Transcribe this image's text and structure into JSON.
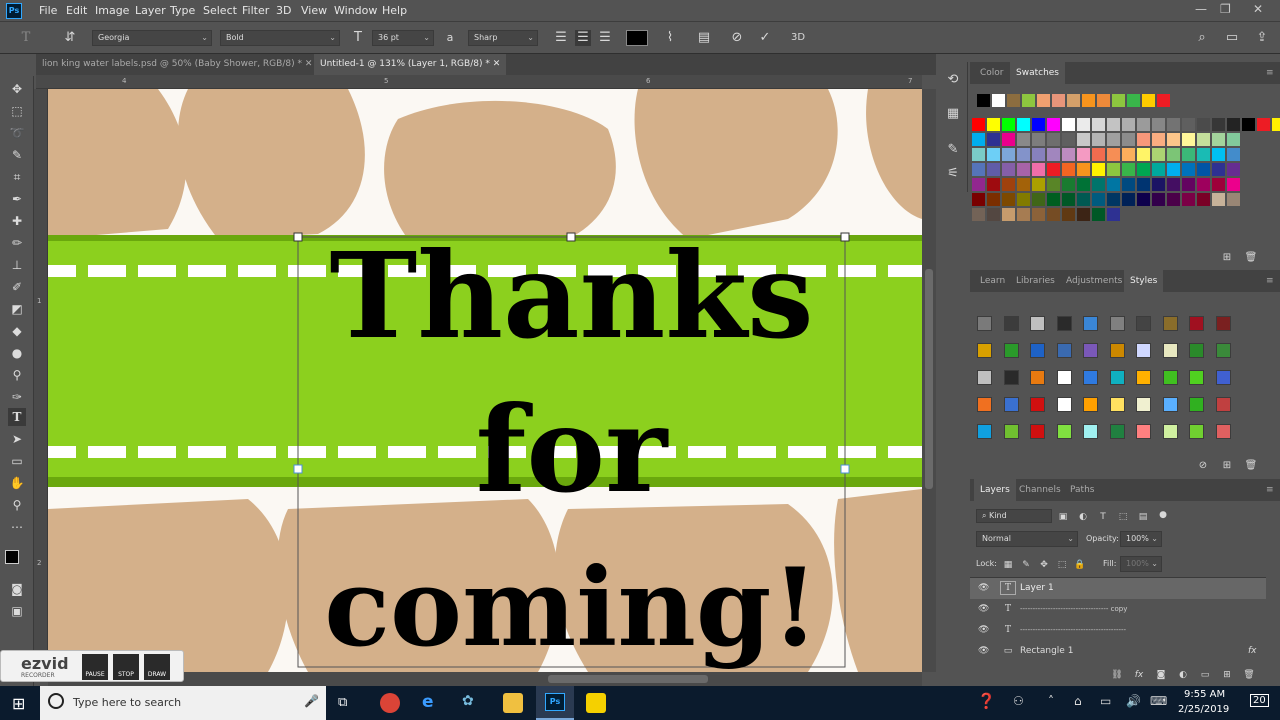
{
  "app": {
    "logo": "Ps"
  },
  "menu": [
    "File",
    "Edit",
    "Image",
    "Layer",
    "Type",
    "Select",
    "Filter",
    "3D",
    "View",
    "Window",
    "Help"
  ],
  "window_controls": {
    "minimize": "—",
    "maximize": "❐",
    "close": "✕"
  },
  "options": {
    "font_family": "Georgia",
    "font_style": "Bold",
    "font_size": "36 pt",
    "antialias_icon": "a",
    "antialias": "Sharp",
    "text_color": "#000000"
  },
  "tabs": [
    {
      "label": "lion king water labels.psd @ 50% (Baby Shower, RGB/8) *",
      "close": "✕"
    },
    {
      "label": "Untitled-1 @ 131% (Layer 1, RGB/8) *",
      "close": "✕"
    }
  ],
  "ruler": {
    "top": [
      "4",
      "5",
      "6",
      "7"
    ],
    "left": [
      "1",
      "2"
    ]
  },
  "canvas": {
    "line1": "Thanks",
    "line2": "for",
    "line3": "coming!",
    "colors": {
      "giraffe": "#d4b08a",
      "band": "#8cd01e",
      "band_dark": "#6aa80d",
      "stitch": "#ffffff"
    }
  },
  "color_panel": {
    "tabs": [
      "Color",
      "Swatches"
    ],
    "active_tab": "Swatches",
    "top_row": [
      "#000000",
      "#ffffff",
      "#8c6d3f",
      "#8dc63f",
      "#f0a070",
      "#e8957a",
      "#d4a06a",
      "#f7941d",
      "#ee8a3a",
      "#8dc63f",
      "#39b54a",
      "#ffcc00",
      "#ed1c24"
    ],
    "grid": [
      [
        "#ff0000",
        "#ffff00",
        "#00ff00",
        "#00ffff",
        "#0000ff",
        "#ff00ff",
        "#ffffff",
        "#ebebeb",
        "#d7d7d7",
        "#c3c3c3",
        "#afafaf",
        "#9b9b9b",
        "#878787",
        "#737373",
        "#5f5f5f",
        "#4b4b4b",
        "#373737",
        "#232323",
        "#000000",
        "#ed1c24",
        "#fff200",
        "#00a651"
      ],
      [
        "#00aeef",
        "#2e3192",
        "#ec008c",
        "#898989",
        "#7d7d7d",
        "#6e6e6e",
        "#5f5f5f",
        "#c8c8c8",
        "#b4b4b4",
        "#a0a0a0",
        "#8c8c8c",
        "#f7977a",
        "#f9ad81",
        "#fdc68a",
        "#fff79a",
        "#c4df9b",
        "#a3d39c",
        "#82ca9c"
      ],
      [
        "#7accc8",
        "#6dcff6",
        "#7da7d9",
        "#8393ca",
        "#8781bd",
        "#a186be",
        "#bd8cbf",
        "#f49ac2",
        "#f26c4f",
        "#f68e55",
        "#fbaf5c",
        "#fff467",
        "#acd372",
        "#7cc576",
        "#3bb878",
        "#1abbb4",
        "#00bff3",
        "#438ccb"
      ],
      [
        "#5574b9",
        "#605ca8",
        "#855fa8",
        "#a763a8",
        "#f06ea9",
        "#ed1c24",
        "#f26522",
        "#f7941d",
        "#fff200",
        "#8dc73f",
        "#39b54a",
        "#00a651",
        "#00a99d",
        "#00aeef",
        "#0072bc",
        "#0054a6",
        "#2e3192",
        "#662d91"
      ],
      [
        "#92278f",
        "#9e0b0f",
        "#a0410d",
        "#a36209",
        "#aba000",
        "#598527",
        "#197b30",
        "#007236",
        "#00746b",
        "#0076a3",
        "#004a80",
        "#003471",
        "#1b1464",
        "#440e62",
        "#630460",
        "#9e005d",
        "#9e0039",
        "#ec008c"
      ],
      [
        "#790000",
        "#7b2e00",
        "#7d4900",
        "#827b00",
        "#406618",
        "#005e20",
        "#005826",
        "#005952",
        "#005b7f",
        "#003663",
        "#002157",
        "#0d004c",
        "#32004b",
        "#4b0049",
        "#7b0046",
        "#7a0026",
        "#c7b299",
        "#998675"
      ],
      [
        "#736357",
        "#534741",
        "#c69c6d",
        "#a67c52",
        "#8c6239",
        "#754c24",
        "#603913",
        "#3c2415",
        "#005826",
        "#2e3192"
      ]
    ]
  },
  "styles_panel": {
    "tabs": [
      "Learn",
      "Libraries",
      "Adjustments",
      "Styles"
    ],
    "active_tab": "Styles",
    "grid": [
      [
        "#7a7a7a",
        "#3c3c3c",
        "#c0c0c0",
        "#2a2a2a",
        "#3a86d6",
        "#808080",
        "#444444",
        "#8a6d2a",
        "#a01020",
        "#7a2020"
      ],
      [
        "#d8a000",
        "#2a9a2a",
        "#1e62c6",
        "#3a6ab0",
        "#7a58b8",
        "#cc8800",
        "#d0d8ff",
        "#e8e8c0",
        "#2a8a2a",
        "#3a8a3a"
      ],
      [
        "#c0c0c0",
        "#2a2a2a",
        "#e87a10",
        "#ffffff",
        "#2f7ae0",
        "#10b0c0",
        "#ffb000",
        "#40c020",
        "#50d020",
        "#4060d0"
      ],
      [
        "#f07020",
        "#3a70d0",
        "#d01010",
        "#ffffff",
        "#ffa000",
        "#ffe060",
        "#f0f0d0",
        "#5ab0ff",
        "#30b020",
        "#c04040"
      ],
      [
        "#10a0e0",
        "#70c030",
        "#d01010",
        "#80e040",
        "#a0f0f0",
        "#208040",
        "#ff8080",
        "#d0f0a0",
        "#70d030",
        "#e06060"
      ]
    ]
  },
  "layers_panel": {
    "tabs": [
      "Layers",
      "Channels",
      "Paths"
    ],
    "active_tab": "Layers",
    "search": "Kind",
    "blend_mode": "Normal",
    "opacity_label": "Opacity:",
    "opacity": "100%",
    "lock_label": "Lock:",
    "fill_label": "Fill:",
    "fill": "100%",
    "layers": [
      {
        "name": "Layer 1",
        "kind": "T",
        "selected": true
      },
      {
        "name": "----------------------------------- copy",
        "kind": "T",
        "selected": false
      },
      {
        "name": "------------------------------------------",
        "kind": "T",
        "selected": false
      },
      {
        "name": "Rectangle 1",
        "kind": "▭",
        "selected": false,
        "fx": "fx"
      }
    ]
  },
  "ezvid": {
    "logo": "ezvid",
    "sub": "RECORDER",
    "buttons": [
      "PAUSE",
      "STOP",
      "DRAW"
    ]
  },
  "taskbar": {
    "search_placeholder": "Type here to search",
    "time": "9:55 AM",
    "date": "2/25/2019",
    "notifications": "20"
  }
}
